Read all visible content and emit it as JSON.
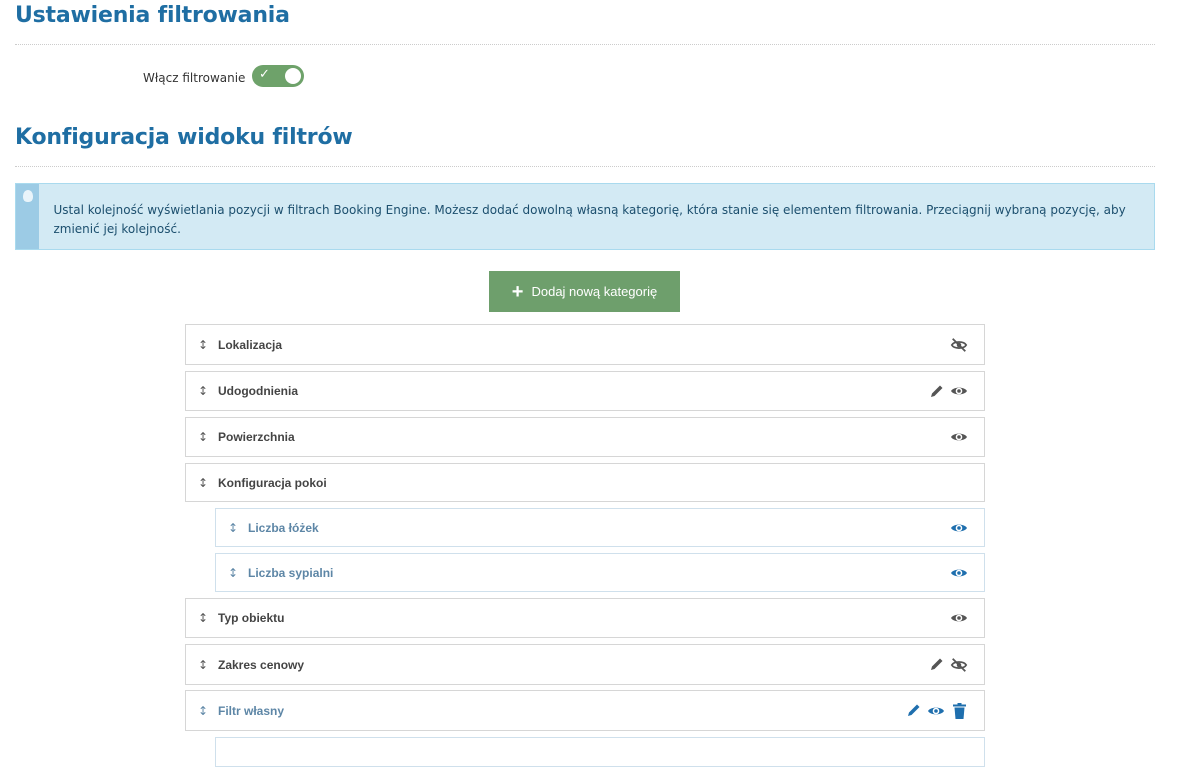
{
  "settings": {
    "title": "Ustawienia filtrowania",
    "toggle_label": "Włącz filtrowanie",
    "toggle_on": true
  },
  "config": {
    "title": "Konfiguracja widoku filtrów",
    "info": "Ustal kolejność wyświetlania pozycji w filtrach Booking Engine. Możesz dodać dowolną własną kategorię, która stanie się elementem filtrowania. Przeciągnij wybraną pozycję, aby zmienić jej kolejność.",
    "add_button": "Dodaj nową kategorię"
  },
  "colors": {
    "accent": "#1f6ea3",
    "button": "#6e9f6c",
    "icon_blue": "#1f6fae",
    "icon_grey": "#555555"
  },
  "items": [
    {
      "label": "Lokalizacja",
      "icons": [
        "eye-slash"
      ],
      "blue": false
    },
    {
      "label": "Udogodnienia",
      "icons": [
        "pencil",
        "eye"
      ],
      "blue": false
    },
    {
      "label": "Powierzchnia",
      "icons": [
        "eye"
      ],
      "blue": false
    },
    {
      "label": "Konfiguracja pokoi",
      "icons": [],
      "blue": false
    },
    {
      "label": "Liczba łóżek",
      "icons": [
        "eye"
      ],
      "blue": true,
      "child": true
    },
    {
      "label": "Liczba sypialni",
      "icons": [
        "eye"
      ],
      "blue": true,
      "child": true
    },
    {
      "label": "Typ obiektu",
      "icons": [
        "eye"
      ],
      "blue": false
    },
    {
      "label": "Zakres cenowy",
      "icons": [
        "pencil",
        "eye-slash"
      ],
      "blue": false
    },
    {
      "label": "Filtr własny",
      "icons": [
        "pencil",
        "eye",
        "trash"
      ],
      "blue": true
    }
  ]
}
